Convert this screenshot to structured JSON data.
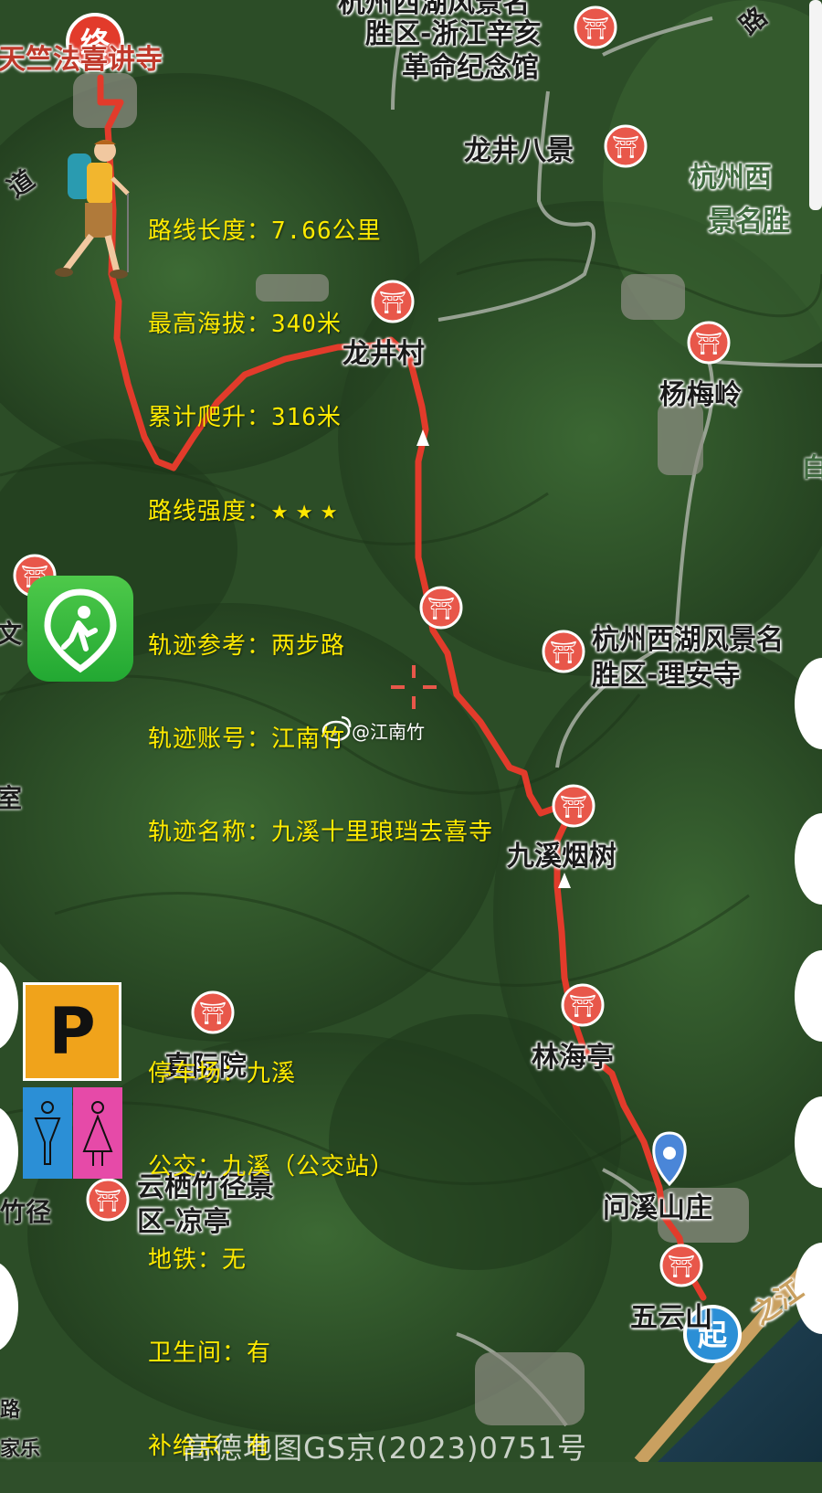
{
  "colors": {
    "route": "#e23b2b",
    "info_text": "#ffea00",
    "poi_marker": "#e8574a",
    "start_marker": "#2b8fd6"
  },
  "route_info": {
    "length": "路线长度：7.66公里",
    "max_altitude": "最高海拔：340米",
    "climb": "累计爬升：316米",
    "intensity": "路线强度："
  },
  "intensity_stars": 3,
  "track_info": {
    "ref": "轨迹参考：两步路",
    "account": "轨迹账号：江南竹",
    "name": "轨迹名称：九溪十里琅珰去喜寺"
  },
  "facilities": {
    "parking": "停车场：九溪",
    "bus": "公交：九溪（公交站）",
    "metro": "地铁：无",
    "toilet": "卫生间：有",
    "supply": "补给点：有"
  },
  "markers": {
    "end": "终",
    "start": "起",
    "parking_letter": "P"
  },
  "places": {
    "end_temple": "天竺法喜讲寺",
    "museum_1": "杭州西湖风景名",
    "museum_2": "胜区-浙江辛亥",
    "museum_3": "革命纪念馆",
    "longjing_eight": "龙井八景",
    "scenic_right_1": "杭州西",
    "scenic_right_2": "景名胜",
    "longjing_village": "龙井村",
    "yangmeiling": "杨梅岭",
    "lian_temple_1": "杭州西湖风景名",
    "lian_temple_2": "胜区-理安寺",
    "jiuxi_yanshu": "九溪烟树",
    "zhenji": "真际院",
    "linhai": "林海亭",
    "wenxi": "问溪山庄",
    "yunqi_1": "云栖竹径景",
    "yunqi_2": "区-凉亭",
    "wuyun": "五云山",
    "river": "之江",
    "road_left": "道",
    "road_top": "路",
    "edge_wen": "文",
    "edge_shi": "室",
    "edge_zhujing": "竹径",
    "edge_bottom": "路",
    "edge_bottom2": "家乐",
    "edge_right_bai": "白"
  },
  "icons": [
    "hiker-icon",
    "two-steps-app-icon",
    "parking-icon",
    "restroom-icon",
    "temple-poi-icon",
    "start-marker-icon",
    "end-marker-icon",
    "location-pin-icon",
    "target-crosshair-icon",
    "weibo-icon"
  ],
  "watermark": "@江南竹",
  "map_credit": "高德地图GS京(2023)0751号"
}
